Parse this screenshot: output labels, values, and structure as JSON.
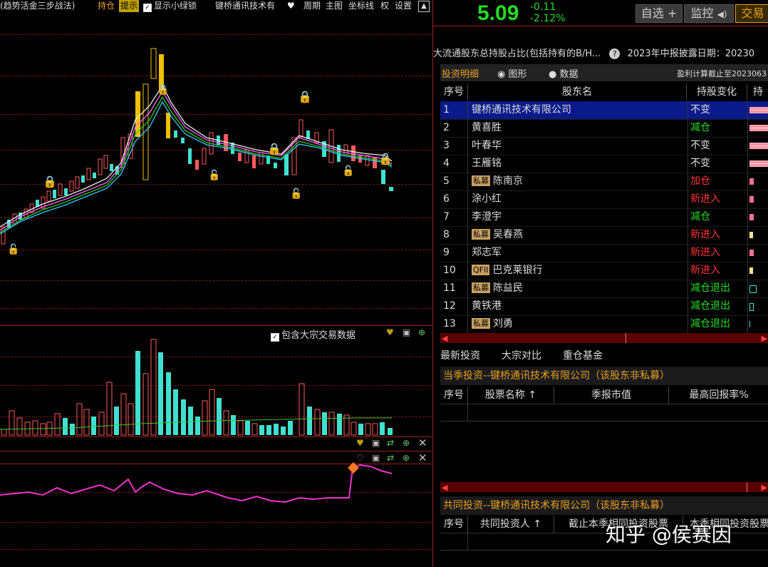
{
  "toolbar": {
    "strategy": "(趋势活金三步战法)",
    "hold": "持仓",
    "tip": "提示",
    "show_lock": "显示小绿锁",
    "stock_name": "键桥通讯技术有",
    "period": "周期",
    "main_chart": "主图",
    "crosshair": "坐标线",
    "rights": "权",
    "settings": "设置"
  },
  "volume_panel": {
    "include_block": "包含大宗交易数据"
  },
  "quote": {
    "price": "5.09",
    "change": "-0.11",
    "change_pct": "-2.12%"
  },
  "buttons": {
    "watchlist": "自选",
    "monitor": "监控",
    "trade": "交易"
  },
  "summary": {
    "title": "大流通股东总持股占比(包括持有的B/H...",
    "disclosure": "2023年中报披露日期：20230"
  },
  "tabs": {
    "detail": "投资明细",
    "graph": "图形",
    "data": "数据",
    "profit_note": "盈利计算截止至2023063"
  },
  "table": {
    "headers": [
      "序号",
      "股东名",
      "持股变化",
      "持"
    ],
    "rows": [
      {
        "no": "1",
        "tag": "",
        "name": "键桥通讯技术有限公司",
        "change": "不变",
        "color": "#dddddd",
        "bar": "pinkstripe"
      },
      {
        "no": "2",
        "tag": "",
        "name": "黄喜胜",
        "change": "减仓",
        "color": "#22dd22",
        "bar": "pinkstripe"
      },
      {
        "no": "3",
        "tag": "",
        "name": "叶春华",
        "change": "不变",
        "color": "#dddddd",
        "bar": "pinkstripe"
      },
      {
        "no": "4",
        "tag": "",
        "name": "王雁铭",
        "change": "不变",
        "color": "#dddddd",
        "bar": "pinkstripe"
      },
      {
        "no": "5",
        "tag": "私募",
        "name": "陈南京",
        "change": "加仓",
        "color": "#ff3333",
        "bar": "pinksmall"
      },
      {
        "no": "6",
        "tag": "",
        "name": "涂小红",
        "change": "新进入",
        "color": "#ff3333",
        "bar": "pinksmall"
      },
      {
        "no": "7",
        "tag": "",
        "name": "李澄宇",
        "change": "减仓",
        "color": "#22dd22",
        "bar": "pinksmall"
      },
      {
        "no": "8",
        "tag": "私募",
        "name": "吴春燕",
        "change": "新进入",
        "color": "#ff3333",
        "bar": "yellowsmall"
      },
      {
        "no": "9",
        "tag": "",
        "name": "郑志军",
        "change": "新进入",
        "color": "#ff3333",
        "bar": "pinksmall"
      },
      {
        "no": "10",
        "tag": "QFII",
        "name": "巴克莱银行",
        "change": "新进入",
        "color": "#ff3333",
        "bar": "yellowsmall"
      },
      {
        "no": "11",
        "tag": "私募",
        "name": "陈益民",
        "change": "减仓退出",
        "color": "#22dd22",
        "bar": "cyanbox"
      },
      {
        "no": "12",
        "tag": "",
        "name": "黄铁港",
        "change": "减仓退出",
        "color": "#22dd22",
        "bar": "cyanthin"
      },
      {
        "no": "13",
        "tag": "私募",
        "name": "刘勇",
        "change": "减仓退出",
        "color": "#22dd22",
        "bar": "cyanline"
      }
    ]
  },
  "links": {
    "latest": "最新投资",
    "block": "大宗对比",
    "fund": "重仓基金"
  },
  "section1": {
    "title": "当季投资--键桥通讯技术有限公司（该股东非私募）",
    "headers": [
      "序号",
      "股票名称",
      "季报市值",
      "最高回报率%"
    ]
  },
  "section2": {
    "title": "共同投资--键桥通讯技术有限公司（该股东非私募）",
    "headers": [
      "序号",
      "共同投资人",
      "截止本季相同投资股票",
      "本季相同投资股票"
    ]
  },
  "watermark": "知乎 @侯赛因",
  "colors": {
    "up": "#ff4444",
    "down": "#22dd22",
    "accent": "#e8a020"
  }
}
